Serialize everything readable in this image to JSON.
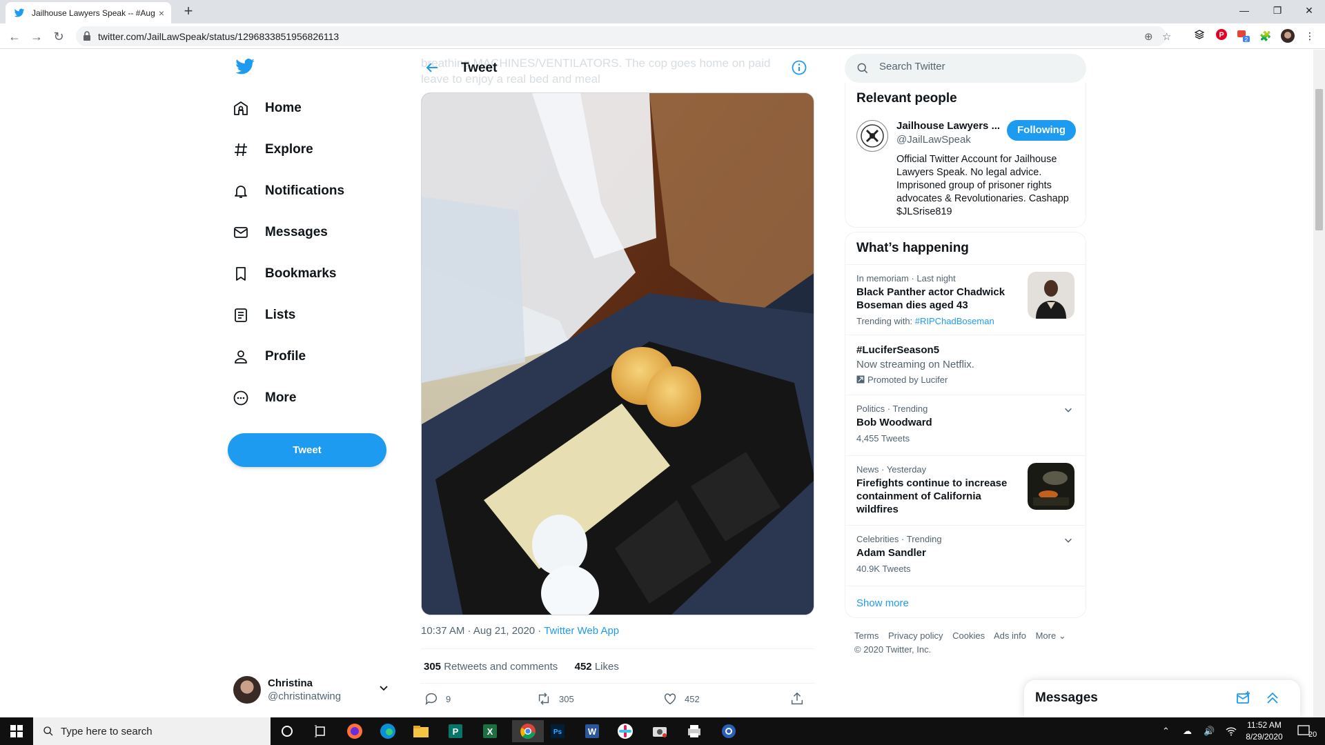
{
  "browser": {
    "tab_title": "Jailhouse Lawyers Speak -- #Aug",
    "tab_close": "×",
    "new_tab": "+",
    "url": "twitter.com/JailLawSpeak/status/1296833851956826113",
    "extension_badge": "2"
  },
  "nav": {
    "items": [
      {
        "label": "Home",
        "icon": "home-icon"
      },
      {
        "label": "Explore",
        "icon": "hashtag-icon"
      },
      {
        "label": "Notifications",
        "icon": "bell-icon"
      },
      {
        "label": "Messages",
        "icon": "envelope-icon"
      },
      {
        "label": "Bookmarks",
        "icon": "bookmark-icon"
      },
      {
        "label": "Lists",
        "icon": "list-icon"
      },
      {
        "label": "Profile",
        "icon": "person-icon"
      },
      {
        "label": "More",
        "icon": "more-circle-icon"
      }
    ],
    "tweet_button": "Tweet",
    "account": {
      "name": "Christina",
      "handle": "@christinatwing"
    }
  },
  "tweet": {
    "header_title": "Tweet",
    "background_text": "breathing MACHINES/VENTILATORS. The cop goes home on paid leave to enjoy a real bed and meal",
    "timestamp": "10:37 AM · Aug 21, 2020 · ",
    "source": "Twitter Web App",
    "retweets_count": "305",
    "retweets_label": "Retweets and comments",
    "likes_count": "452",
    "likes_label": "Likes",
    "actions": {
      "replies": "9",
      "retweets": "305",
      "likes": "452"
    }
  },
  "sidebar": {
    "search_placeholder": "Search Twitter",
    "relevant_people": {
      "title": "Relevant people",
      "name": "Jailhouse Lawyers ...",
      "handle": "@JailLawSpeak",
      "follow_label": "Following",
      "bio": "Official Twitter Account for Jailhouse Lawyers Speak. No legal advice. Imprisoned group of prisoner rights advocates & Revolutionaries. Cashapp $JLSrise819"
    },
    "whats_happening": {
      "title": "What’s happening",
      "trends": [
        {
          "meta": "In memoriam · Last night",
          "title": "Black Panther actor Chadwick Boseman dies aged 43",
          "sub_label": "Trending with: ",
          "sub_link": "#RIPChadBoseman"
        },
        {
          "title": "#LuciferSeason5",
          "desc": "Now streaming on Netflix.",
          "promoted": "Promoted by Lucifer"
        },
        {
          "meta": "Politics · Trending",
          "title": "Bob Woodward",
          "sub": "4,455 Tweets"
        },
        {
          "meta": "News · Yesterday",
          "title": "Firefights continue to increase containment of California wildfires"
        },
        {
          "meta": "Celebrities · Trending",
          "title": "Adam Sandler",
          "sub": "40.9K Tweets"
        }
      ],
      "show_more": "Show more"
    },
    "footer": {
      "links": [
        "Terms",
        "Privacy policy",
        "Cookies",
        "Ads info",
        "More"
      ],
      "copyright": "© 2020 Twitter, Inc."
    },
    "messages_drawer": "Messages"
  },
  "taskbar": {
    "search_placeholder": "Type here to search",
    "time": "11:52 AM",
    "date": "8/29/2020",
    "notifications": "20"
  },
  "colors": {
    "accent": "#1d9bf0",
    "text": "#0f1419",
    "secondary": "#536471"
  }
}
